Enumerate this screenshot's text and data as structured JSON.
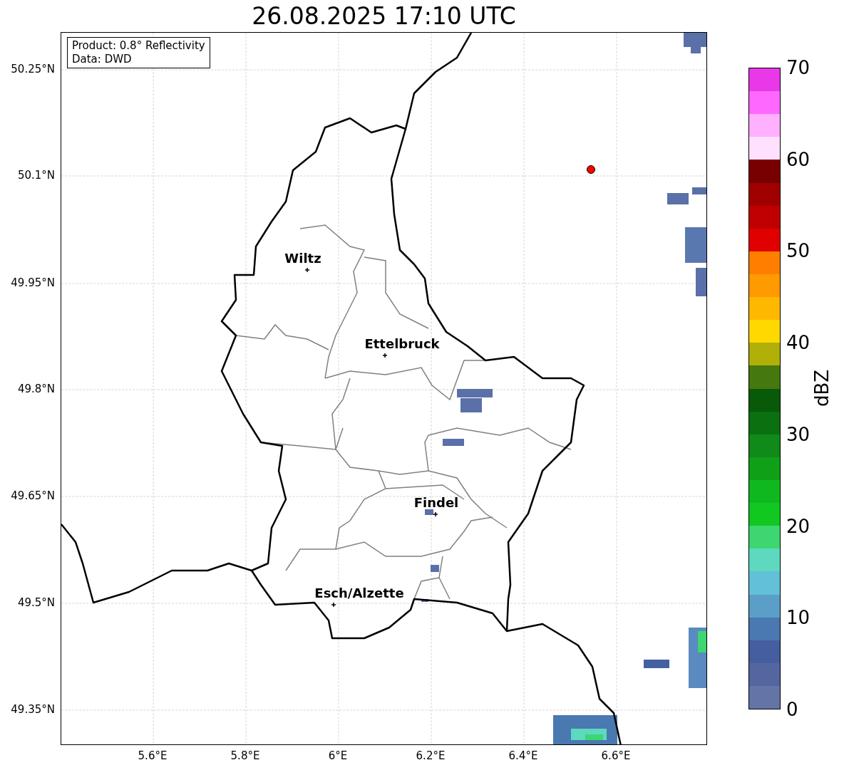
{
  "title": "26.08.2025 17:10 UTC",
  "map": {
    "legend": [
      "Product: 0.8° Reflectivity",
      "Data: DWD"
    ],
    "lat_labels": [
      "50.25°N",
      "50.1°N",
      "49.95°N",
      "49.8°N",
      "49.65°N",
      "49.5°N",
      "49.35°N"
    ],
    "lon_labels": [
      "5.6°E",
      "5.8°E",
      "6°E",
      "6.2°E",
      "6.4°E",
      "6.6°E"
    ],
    "cities": [
      {
        "name": "Wiltz"
      },
      {
        "name": "Ettelbruck"
      },
      {
        "name": "Findel"
      },
      {
        "name": "Esch/Alzette"
      }
    ]
  },
  "colorbar": {
    "label": "dBZ",
    "ticks": [
      "70",
      "60",
      "50",
      "40",
      "30",
      "20",
      "10",
      "0"
    ],
    "bins": [
      {
        "color": "#e838e8"
      },
      {
        "color": "#ff68ff"
      },
      {
        "color": "#ffb0ff"
      },
      {
        "color": "#ffe0ff"
      },
      {
        "color": "#780000"
      },
      {
        "color": "#a00000"
      },
      {
        "color": "#c00000"
      },
      {
        "color": "#e00000"
      },
      {
        "color": "#ff7e00"
      },
      {
        "color": "#ff9a00"
      },
      {
        "color": "#ffb800"
      },
      {
        "color": "#ffd800"
      },
      {
        "color": "#b0b008"
      },
      {
        "color": "#467810"
      },
      {
        "color": "#085a08"
      },
      {
        "color": "#0a7010"
      },
      {
        "color": "#108a18"
      },
      {
        "color": "#10a018"
      },
      {
        "color": "#10b820"
      },
      {
        "color": "#10c820"
      },
      {
        "color": "#3dd670"
      },
      {
        "color": "#5fd8c0"
      },
      {
        "color": "#62c0d8"
      },
      {
        "color": "#5b9ec8"
      },
      {
        "color": "#4a78b0"
      },
      {
        "color": "#445ea0"
      },
      {
        "color": "#5466a0"
      },
      {
        "color": "#6474a6"
      }
    ]
  }
}
